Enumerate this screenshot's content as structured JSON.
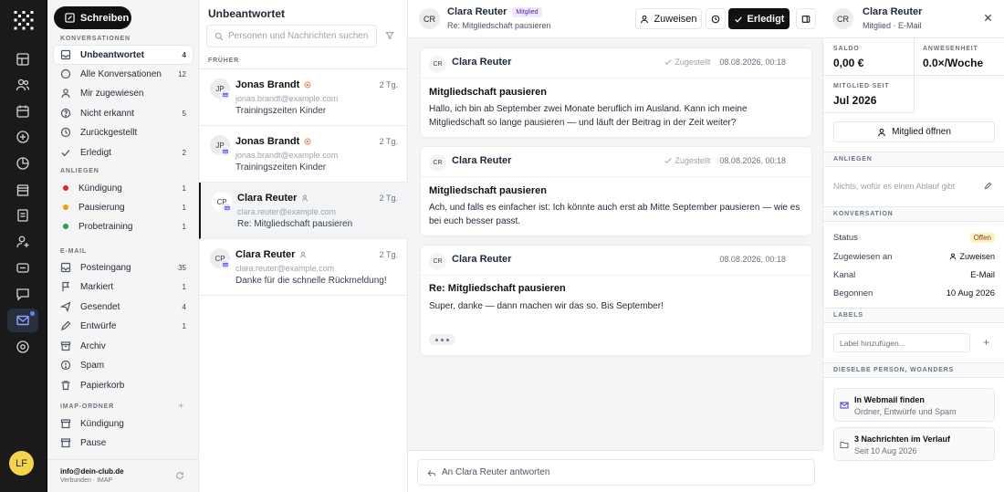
{
  "rail": {
    "user_initials": "LF",
    "items": [
      {
        "name": "dashboard"
      },
      {
        "name": "members"
      },
      {
        "name": "calendar"
      },
      {
        "name": "coins"
      },
      {
        "name": "analytics"
      },
      {
        "name": "store"
      },
      {
        "name": "documents"
      },
      {
        "name": "user-add"
      },
      {
        "name": "messages"
      },
      {
        "name": "chat"
      },
      {
        "name": "mail"
      },
      {
        "name": "settings"
      }
    ]
  },
  "sidebar": {
    "compose_label": "Schreiben",
    "conversations_header": "Konversationen",
    "conversations": [
      {
        "label": "Unbeantwortet",
        "count": "4"
      },
      {
        "label": "Alle Konversationen",
        "count": "12"
      },
      {
        "label": "Mir zugewiesen",
        "count": ""
      },
      {
        "label": "Nicht erkannt",
        "count": "5"
      },
      {
        "label": "Zurückgestellt",
        "count": ""
      },
      {
        "label": "Erledigt",
        "count": "2"
      }
    ],
    "concerns_header": "Anliegen",
    "concerns": [
      {
        "label": "Kündigung",
        "count": "1",
        "color": "#dc2626"
      },
      {
        "label": "Pausierung",
        "count": "1",
        "color": "#f59e0b"
      },
      {
        "label": "Probetraining",
        "count": "1",
        "color": "#16a34a"
      }
    ],
    "email_header": "E-Mail",
    "email": [
      {
        "label": "Posteingang",
        "count": "35"
      },
      {
        "label": "Markiert",
        "count": "1"
      },
      {
        "label": "Gesendet",
        "count": "4"
      },
      {
        "label": "Entwürfe",
        "count": "1"
      },
      {
        "label": "Archiv",
        "count": ""
      },
      {
        "label": "Spam",
        "count": ""
      },
      {
        "label": "Papierkorb",
        "count": ""
      }
    ],
    "imap_header": "IMAP-Ordner",
    "imap_plus": "+",
    "imap": [
      {
        "label": "Kündigung"
      },
      {
        "label": "Pause"
      }
    ],
    "account": "info@dein-club.de",
    "account_status": "Verbunden · IMAP"
  },
  "list": {
    "title": "Unbeantwortet",
    "search_placeholder": "Personen und Nachrichten suchen",
    "group_label": "Früher",
    "items": [
      {
        "initials": "JP",
        "name": "Jonas Brandt",
        "email": "jonas.brandt@example.com",
        "subject": "Trainingszeiten Kinder",
        "time": "2 Tg."
      },
      {
        "initials": "JP",
        "name": "Jonas Brandt",
        "email": "jonas.brandt@example.com",
        "subject": "Trainingszeiten Kinder",
        "time": "2 Tg."
      },
      {
        "initials": "CP",
        "name": "Clara Reuter",
        "email": "clara.reuter@example.com",
        "subject": "Re: Mitgliedschaft pausieren",
        "time": "2 Tg."
      },
      {
        "initials": "CP",
        "name": "Clara Reuter",
        "email": "clara.reuter@example.com",
        "subject": "Danke für die schnelle Rückmeldung!",
        "time": "2 Tg."
      }
    ]
  },
  "thread": {
    "initials": "CR",
    "name": "Clara Reuter",
    "badge": "Mitglied",
    "subject": "Re: Mitgliedschaft pausieren",
    "assign_label": "Zuweisen",
    "done_label": "Erledigt",
    "reply_label": "An Clara Reuter antworten",
    "messages": [
      {
        "initials": "CR",
        "sender": "Clara Reuter",
        "status": "Zugestellt",
        "date": "08.08.2026, 00:18",
        "title": "Mitgliedschaft pausieren",
        "body": "Hallo, ich bin ab September zwei Monate beruflich im Ausland. Kann ich meine Mitgliedschaft so lange pausieren — und läuft der Beitrag in der Zeit weiter?"
      },
      {
        "initials": "CR",
        "sender": "Clara Reuter",
        "status": "Zugestellt",
        "date": "08.08.2026, 00:18",
        "title": "Mitgliedschaft pausieren",
        "body": "Ach, und falls es einfacher ist: Ich könnte auch erst ab Mitte September pausieren — wie es bei euch besser passt."
      },
      {
        "initials": "CR",
        "sender": "Clara Reuter",
        "status": "",
        "date": "08.08.2026, 00:18",
        "title": "Re: Mitgliedschaft pausieren",
        "body": "Super, danke — dann machen wir das so. Bis September!"
      }
    ]
  },
  "details": {
    "initials": "CR",
    "name": "Clara Reuter",
    "subtitle": "Mitglied · E-Mail",
    "saldo_label": "Saldo",
    "saldo_value": "0,00 €",
    "attendance_label": "Anwesenheit",
    "attendance_value": "0.0×/Woche",
    "member_since_label": "Mitglied seit",
    "member_since_value": "Jul 2026",
    "open_member_label": "Mitglied öffnen",
    "concerns_header": "Anliegen",
    "concerns_text": "Nichts, wofür es einen Ablauf gibt",
    "conversation_header": "Konversation",
    "status_label": "Status",
    "status_value": "Offen",
    "assigned_label": "Zugewiesen an",
    "assigned_value": "Zuweisen",
    "channel_label": "Kanal",
    "channel_value": "E-Mail",
    "started_label": "Begonnen",
    "started_value": "10 Aug 2026",
    "labels_header": "Labels",
    "label_placeholder": "Label hinzufügen...",
    "label_plus": "+",
    "elsewhere_header": "Dieselbe Person, woanders",
    "cards": [
      {
        "title": "In Webmail finden",
        "sub": "Ordner, Entwürfe und Spam"
      },
      {
        "title": "3 Nachrichten im Verlauf",
        "sub": "Seit 10 Aug 2026"
      }
    ]
  }
}
